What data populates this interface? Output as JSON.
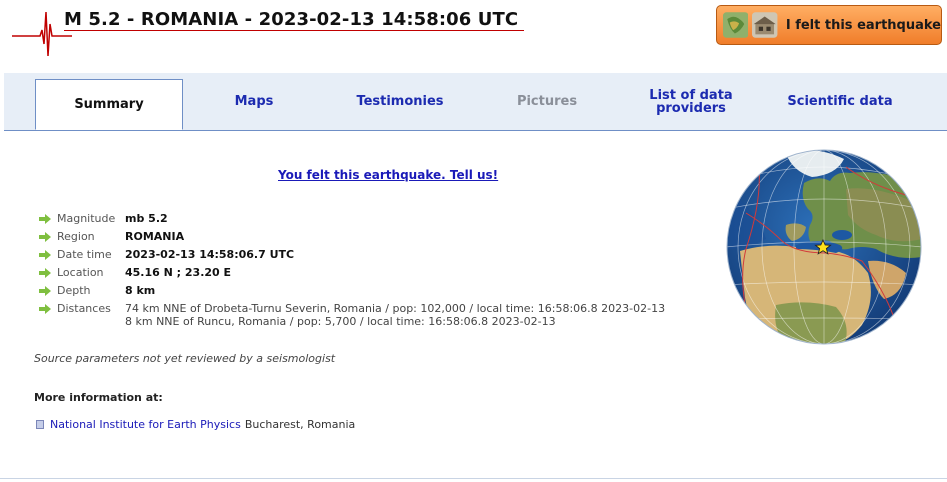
{
  "header": {
    "title": "M 5.2 - ROMANIA - 2023-02-13 14:58:06 UTC",
    "felt_button_label": "I felt this earthquake",
    "accent_color": "#c00000"
  },
  "tabs": [
    {
      "label": "Summary",
      "active": true
    },
    {
      "label": "Maps"
    },
    {
      "label": "Testimonies"
    },
    {
      "label": "Pictures",
      "disabled": true
    },
    {
      "label": "List of data providers"
    },
    {
      "label": "Scientific data"
    }
  ],
  "main": {
    "tell_us_link": "You felt this earthquake. Tell us!",
    "params": [
      {
        "label": "Magnitude",
        "value": "mb 5.2"
      },
      {
        "label": "Region",
        "value": "ROMANIA"
      },
      {
        "label": "Date time",
        "value": "2023-02-13 14:58:06.7 UTC"
      },
      {
        "label": "Location",
        "value": "45.16 N ; 23.20 E"
      },
      {
        "label": "Depth",
        "value": "8 km"
      }
    ],
    "distances_label": "Distances",
    "distances": [
      "74 km NNE of Drobeta-Turnu Severin, Romania / pop: 102,000 / local time: 16:58:06.8 2023-02-13",
      "8 km NNE of Runcu, Romania / pop: 5,700 / local time: 16:58:06.8 2023-02-13"
    ],
    "review_note": "Source parameters not yet reviewed by a seismologist",
    "more_info_heading": "More information at:",
    "source_link": "National Institute for Earth Physics",
    "source_rest": "Bucharest, Romania"
  },
  "icons": {
    "param_bullet": "green-arrow-icon",
    "source_bullet": "document-icon",
    "logo": "seismogram-logo-icon",
    "map": "globe-map-icon"
  }
}
